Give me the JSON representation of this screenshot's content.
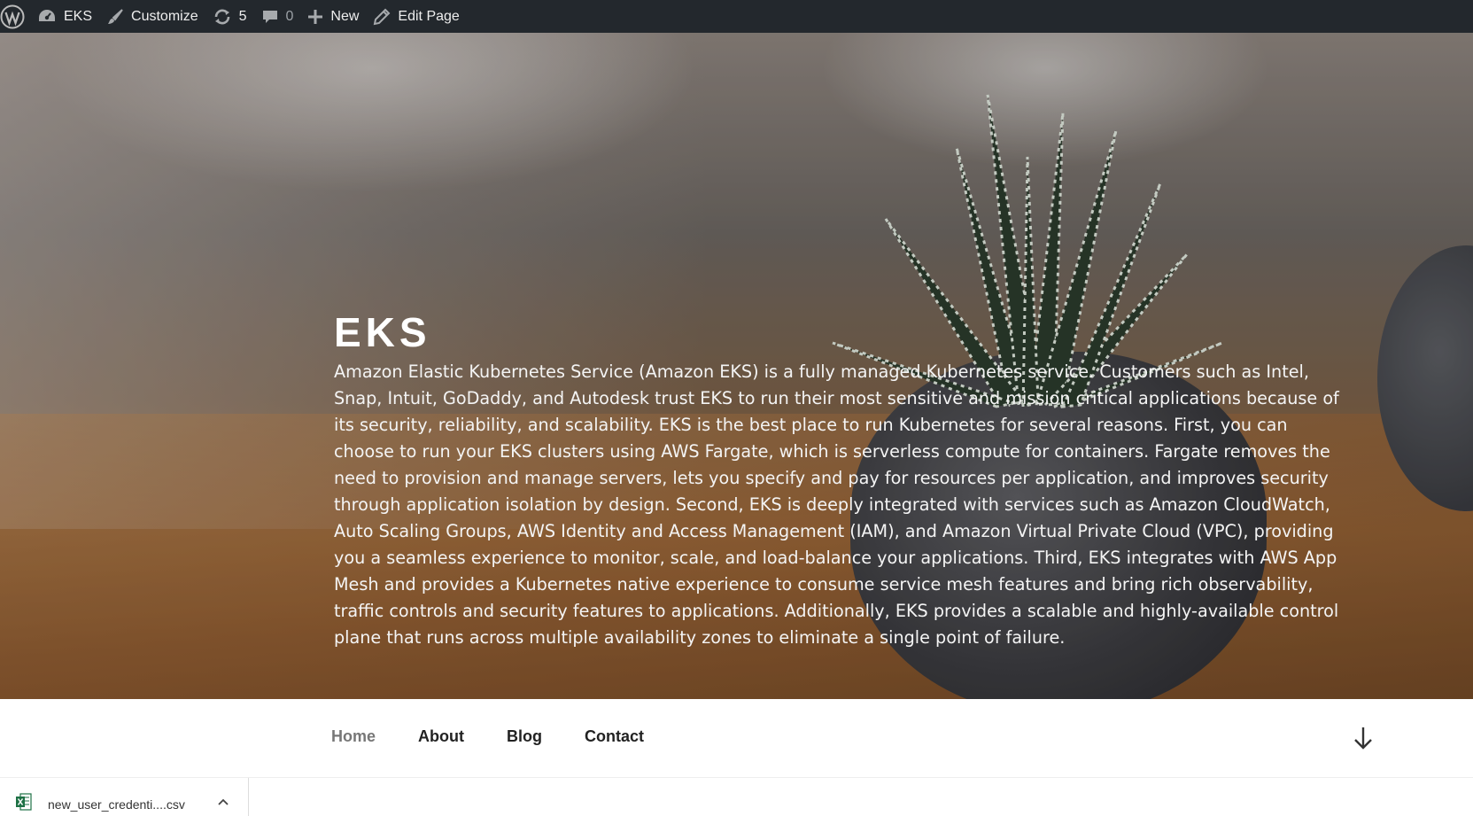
{
  "adminbar": {
    "site_name": "EKS",
    "customize_label": "Customize",
    "updates_count": "5",
    "comments_count": "0",
    "new_label": "New",
    "edit_label": "Edit Page"
  },
  "hero": {
    "title": "EKS",
    "description": "Amazon Elastic Kubernetes Service (Amazon EKS) is a fully managed Kubernetes service. Customers such as Intel, Snap, Intuit, GoDaddy, and Autodesk trust EKS to run their most sensitive and mission critical applications because of its security, reliability, and scalability. EKS is the best place to run Kubernetes for several reasons. First, you can choose to run your EKS clusters using AWS Fargate, which is serverless compute for containers. Fargate removes the need to provision and manage servers, lets you specify and pay for resources per application, and improves security through application isolation by design. Second, EKS is deeply integrated with services such as Amazon CloudWatch, Auto Scaling Groups, AWS Identity and Access Management (IAM), and Amazon Virtual Private Cloud (VPC), providing you a seamless experience to monitor, scale, and load-balance your applications. Third, EKS integrates with AWS App Mesh and provides a Kubernetes native experience to consume service mesh features and bring rich observability, traffic controls and security features to applications. Additionally, EKS provides a scalable and highly-available control plane that runs across multiple availability zones to eliminate a single point of failure."
  },
  "nav": {
    "items": [
      {
        "label": "Home"
      },
      {
        "label": "About"
      },
      {
        "label": "Blog"
      },
      {
        "label": "Contact"
      }
    ]
  },
  "downloads": {
    "file_name": "new_user_credenti....csv"
  }
}
